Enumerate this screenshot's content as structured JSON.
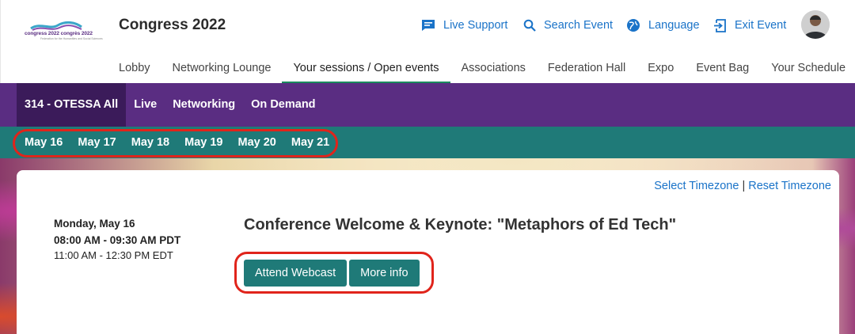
{
  "header": {
    "logo_text": "congress 2022  congrès 2022",
    "logo_subtext": "Federation for the Humanities and Social Sciences",
    "app_title": "Congress 2022",
    "utility": [
      {
        "label": "Live Support",
        "icon": "chat-icon"
      },
      {
        "label": "Search Event",
        "icon": "search-icon"
      },
      {
        "label": "Language",
        "icon": "globe-icon"
      },
      {
        "label": "Exit Event",
        "icon": "exit-icon"
      }
    ]
  },
  "main_nav": {
    "items": [
      {
        "label": "Lobby"
      },
      {
        "label": "Networking Lounge"
      },
      {
        "label": "Your sessions / Open events",
        "active": true
      },
      {
        "label": "Associations"
      },
      {
        "label": "Federation Hall"
      },
      {
        "label": "Expo"
      },
      {
        "label": "Event Bag"
      },
      {
        "label": "Your Schedule"
      }
    ]
  },
  "sub_nav": {
    "tabs": [
      {
        "label": "314 - OTESSA All",
        "active": true
      },
      {
        "label": "Live"
      },
      {
        "label": "Networking"
      },
      {
        "label": "On Demand"
      }
    ]
  },
  "dates": [
    "May 16",
    "May 17",
    "May 18",
    "May 19",
    "May 20",
    "May 21"
  ],
  "timezone": {
    "select_label": "Select Timezone",
    "separator": "|",
    "reset_label": "Reset Timezone"
  },
  "session": {
    "day": "Monday, May 16",
    "time_pdt": "08:00 AM - 09:30 AM PDT",
    "time_edt": "11:00 AM - 12:30 PM EDT",
    "title": "Conference Welcome & Keynote: \"Metaphors of Ed Tech\"",
    "attend_label": "Attend Webcast",
    "info_label": "More info"
  },
  "colors": {
    "purple_bar": "#5a2d82",
    "teal_bar": "#1f7a78",
    "link_blue": "#1a73c8",
    "highlight_red": "#e0241b",
    "nav_active_underline": "#1a8a5e"
  }
}
